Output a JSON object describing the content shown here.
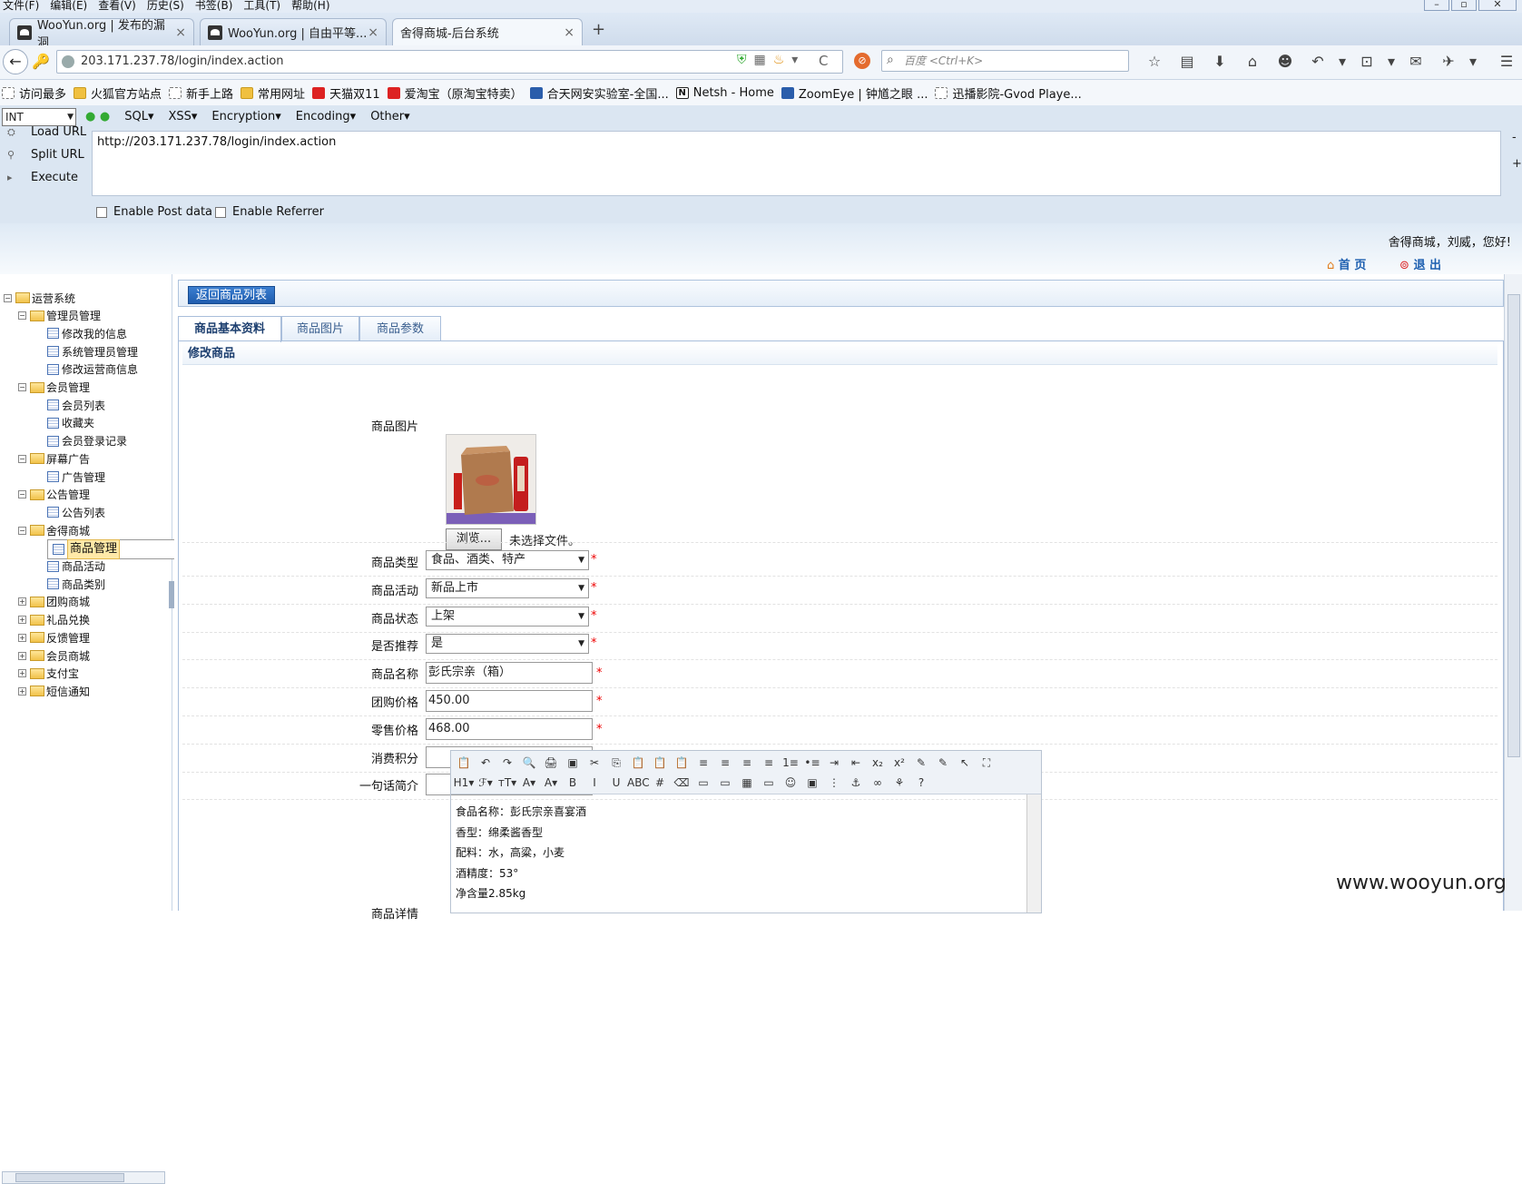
{
  "menubar": {
    "items": [
      "文件(F)",
      "编辑(E)",
      "查看(V)",
      "历史(S)",
      "书签(B)",
      "工具(T)",
      "帮助(H)"
    ]
  },
  "window_controls": {
    "minimize": "–",
    "restore": "▫",
    "close": "✕"
  },
  "tabs": [
    {
      "label": "WooYun.org | 发布的漏洞"
    },
    {
      "label": "WooYun.org | 自由平等..."
    },
    {
      "label": "舍得商城-后台系统"
    }
  ],
  "tab_close": "×",
  "new_tab": "+",
  "nav": {
    "back": "←",
    "url": "203.171.237.78/login/index.action",
    "search_placeholder": "百度 <Ctrl+K>",
    "reload": "C"
  },
  "bookmarks": [
    {
      "label": "访问最多",
      "icon": "page"
    },
    {
      "label": "火狐官方站点",
      "icon": "folder"
    },
    {
      "label": "新手上路",
      "icon": "page"
    },
    {
      "label": "常用网址",
      "icon": "folder"
    },
    {
      "label": "天猫双11",
      "icon": "red"
    },
    {
      "label": "爱淘宝（原淘宝特卖）",
      "icon": "red"
    },
    {
      "label": "合天网安实验室-全国...",
      "icon": "blue"
    },
    {
      "label": "Netsh - Home",
      "icon": "n"
    },
    {
      "label": "ZoomEye | 钟馗之眼 ...",
      "icon": "blue"
    },
    {
      "label": "迅播影院-Gvod Playe...",
      "icon": "page"
    }
  ],
  "hackbar": {
    "select": "INT",
    "menus": [
      "SQL▾",
      "XSS▾",
      "Encryption▾",
      "Encoding▾",
      "Other▾"
    ],
    "load": "Load URL",
    "split": "Split URL",
    "execute": "Execute",
    "url": "http://203.171.237.78/login/index.action",
    "post": "Enable Post data",
    "referrer": "Enable Referrer"
  },
  "header": {
    "greeting": "舍得商城，刘威，您好!",
    "home": "首 页",
    "logout": "退 出"
  },
  "tree": [
    {
      "label": "运营系统",
      "level": 0,
      "type": "root",
      "pm": "−"
    },
    {
      "label": "管理员管理",
      "level": 1,
      "type": "folder",
      "pm": "−"
    },
    {
      "label": "修改我的信息",
      "level": 2,
      "type": "page"
    },
    {
      "label": "系统管理员管理",
      "level": 2,
      "type": "page"
    },
    {
      "label": "修改运营商信息",
      "level": 2,
      "type": "page"
    },
    {
      "label": "会员管理",
      "level": 1,
      "type": "folder",
      "pm": "−"
    },
    {
      "label": "会员列表",
      "level": 2,
      "type": "page"
    },
    {
      "label": "收藏夹",
      "level": 2,
      "type": "page"
    },
    {
      "label": "会员登录记录",
      "level": 2,
      "type": "page"
    },
    {
      "label": "屏幕广告",
      "level": 1,
      "type": "folder",
      "pm": "−"
    },
    {
      "label": "广告管理",
      "level": 2,
      "type": "page"
    },
    {
      "label": "公告管理",
      "level": 1,
      "type": "folder",
      "pm": "−"
    },
    {
      "label": "公告列表",
      "level": 2,
      "type": "page"
    },
    {
      "label": "舍得商城",
      "level": 1,
      "type": "folder",
      "pm": "−"
    },
    {
      "label": "商品管理",
      "level": 2,
      "type": "page",
      "selected": true
    },
    {
      "label": "商品活动",
      "level": 2,
      "type": "page"
    },
    {
      "label": "商品类别",
      "level": 2,
      "type": "page"
    },
    {
      "label": "团购商城",
      "level": 1,
      "type": "folder",
      "pm": "+"
    },
    {
      "label": "礼品兑换",
      "level": 1,
      "type": "folder",
      "pm": "+"
    },
    {
      "label": "反馈管理",
      "level": 1,
      "type": "folder",
      "pm": "+"
    },
    {
      "label": "会员商城",
      "level": 1,
      "type": "folder",
      "pm": "+"
    },
    {
      "label": "支付宝",
      "level": 1,
      "type": "folder",
      "pm": "+"
    },
    {
      "label": "短信通知",
      "level": 1,
      "type": "folder",
      "pm": "+"
    }
  ],
  "main": {
    "back_button": "返回商品列表",
    "tabs": [
      "商品基本资料",
      "商品图片",
      "商品参数"
    ],
    "panel_title": "修改商品",
    "image_label": "商品图片",
    "browse": "浏览...",
    "no_file": "未选择文件。",
    "fields": [
      {
        "label": "商品类型",
        "kind": "select",
        "value": "食品、酒类、特产"
      },
      {
        "label": "商品活动",
        "kind": "select",
        "value": "新品上市"
      },
      {
        "label": "商品状态",
        "kind": "select",
        "value": "上架"
      },
      {
        "label": "是否推荐",
        "kind": "select",
        "value": "是"
      },
      {
        "label": "商品名称",
        "kind": "input",
        "value": "彭氏宗亲（箱）"
      },
      {
        "label": "团购价格",
        "kind": "input",
        "value": "450.00"
      },
      {
        "label": "零售价格",
        "kind": "input",
        "value": "468.00"
      },
      {
        "label": "消费积分",
        "kind": "input",
        "value": ""
      },
      {
        "label": "一句话简介",
        "kind": "input",
        "value": ""
      }
    ],
    "required_mark": "*",
    "detail_label": "商品详情",
    "editor_lines": [
      "食品名称：彭氏宗亲喜宴酒",
      "香型：绵柔酱香型",
      "配料：水，高粱，小麦",
      "酒精度：53°",
      "净含量2.85kg"
    ],
    "editor_toolbar_row1": [
      "📋",
      "↶",
      "↷",
      "🔍",
      "🖨",
      "▣",
      "✂",
      "⎘",
      "📋",
      "📋",
      "📋",
      "≡",
      "≡",
      "≡",
      "≡",
      "1≡",
      "•≡",
      "⇥",
      "⇤",
      "x₂",
      "x²",
      "✎",
      "✎",
      "↖",
      "⛶"
    ],
    "editor_toolbar_row2": [
      "H1▾",
      "ℱ▾",
      "тT▾",
      "A▾",
      "A▾",
      "B",
      "I",
      "U",
      "ABC",
      "#",
      "⌫",
      "▭",
      "▭",
      "▦",
      "▭",
      "☺",
      "▣",
      "⋮",
      "⚓",
      "∞",
      "⚘",
      "?"
    ]
  },
  "watermark": "www.wooyun.org"
}
